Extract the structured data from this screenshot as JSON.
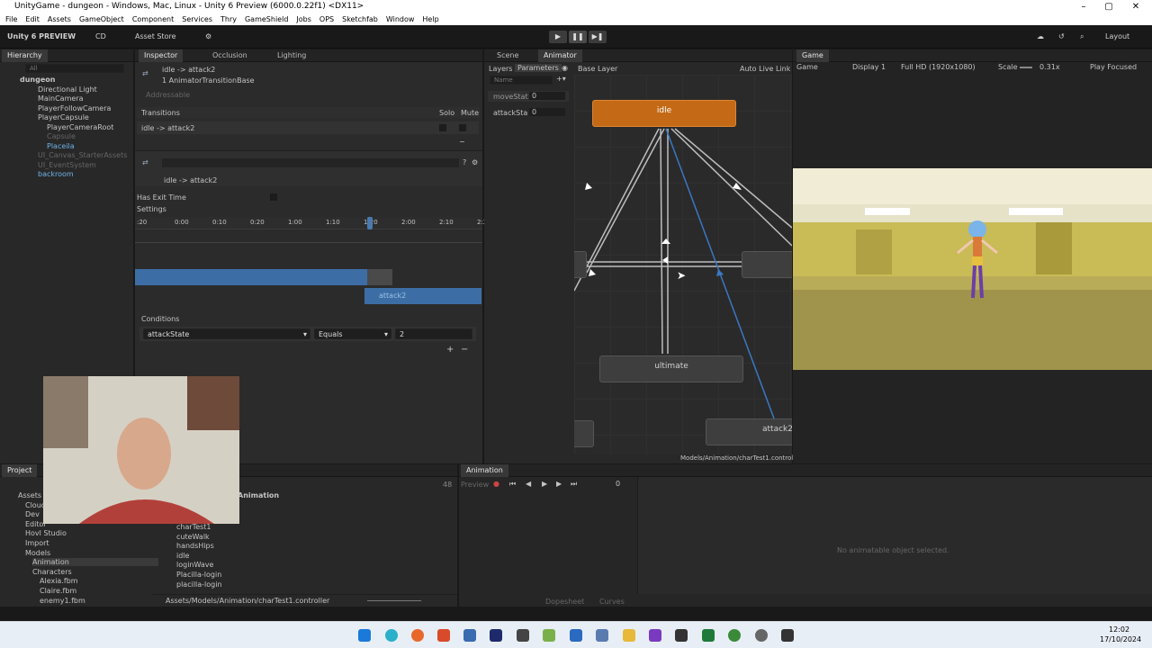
{
  "window": {
    "title": "UnityGame - dungeon - Windows, Mac, Linux - Unity 6 Preview (6000.0.22f1) <DX11>"
  },
  "menu": [
    "File",
    "Edit",
    "Assets",
    "GameObject",
    "Component",
    "Services",
    "Thry",
    "GameShield",
    "Jobs",
    "OPS",
    "Sketchfab",
    "Window",
    "Help"
  ],
  "toolbar": {
    "logo": "Unity 6 PREVIEW",
    "account": "CD",
    "asset_store": "Asset Store",
    "layout": "Layout"
  },
  "hierarchy": {
    "tab": "Hierarchy",
    "search_placeholder": "All",
    "items": [
      {
        "label": "dungeon"
      },
      {
        "label": "Directional Light"
      },
      {
        "label": "MainCamera"
      },
      {
        "label": "PlayerFollowCamera"
      },
      {
        "label": "PlayerCapsule"
      },
      {
        "label": "PlayerCameraRoot"
      },
      {
        "label": "Capsule"
      },
      {
        "label": "Placeila"
      },
      {
        "label": "UI_Canvas_StarterAssets"
      },
      {
        "label": "UI_EventSystem"
      },
      {
        "label": "backroom"
      }
    ]
  },
  "inspector": {
    "tabs": [
      "Inspector",
      "Occlusion",
      "Lighting"
    ],
    "title": "idle -> attack2",
    "subtitle": "1 AnimatorTransitionBase",
    "addressable": "Addressable",
    "transitions_label": "Transitions",
    "solo": "Solo",
    "mute": "Mute",
    "transition_row": "idle -> attack2",
    "sub_title": "idle -> attack2",
    "has_exit_time": "Has Exit Time",
    "settings": "Settings",
    "timeline_ticks": [
      ":20",
      "0:00",
      "0:10",
      "0:20",
      "1:00",
      "1:10",
      "1:20",
      "2:00",
      "2:10",
      "2:20"
    ],
    "attack_clip": "attack2",
    "conditions_label": "Conditions",
    "condition_param": "attackState",
    "condition_op": "Equals",
    "condition_value": "2"
  },
  "animator": {
    "tabs": [
      "Scene",
      "Animator"
    ],
    "subtabs": [
      "Layers",
      "Parameters"
    ],
    "base_layer": "Base Layer",
    "auto_live_link": "Auto Live Link",
    "search_placeholder": "Name",
    "params": [
      {
        "name": "moveStat",
        "value": "0"
      },
      {
        "name": "attackSta",
        "value": "0"
      }
    ],
    "nodes": {
      "idle": "idle",
      "ultimate": "ultimate",
      "attack2": "attack2"
    },
    "path": "Models/Animation/charTest1.controller"
  },
  "game": {
    "tab": "Game",
    "mode": "Game",
    "display": "Display 1",
    "resolution": "Full HD (1920x1080)",
    "scale_label": "Scale",
    "scale_value": "0.31x",
    "play_focused": "Play Focused"
  },
  "project": {
    "tab": "Project",
    "folders": [
      "Assets",
      "Cloud",
      "Dev",
      "Editor",
      "Hovl Studio",
      "Import",
      "Models",
      "Animation",
      "Characters",
      "Alexia.fbm",
      "Claire.fbm",
      "enemy1.fbm"
    ],
    "files_header": "Animation",
    "files": [
      "charTest1",
      "cuteWalk",
      "handsHips",
      "idle",
      "loginWave",
      "Placilla-login",
      "placilla-login"
    ],
    "path": "Assets/Models/Animation/charTest1.controller",
    "count": "48"
  },
  "animation": {
    "tab": "Animation",
    "preview": "Preview",
    "frame": "0",
    "empty": "No animatable object selected.",
    "dopesheet": "Dopesheet",
    "curves": "Curves"
  },
  "taskbar": {
    "time": "12:02",
    "date": "17/10/2024"
  },
  "colors": {
    "accent": "#c46a16",
    "selection": "#2c5d87",
    "transition_blue": "#3a78c2"
  }
}
